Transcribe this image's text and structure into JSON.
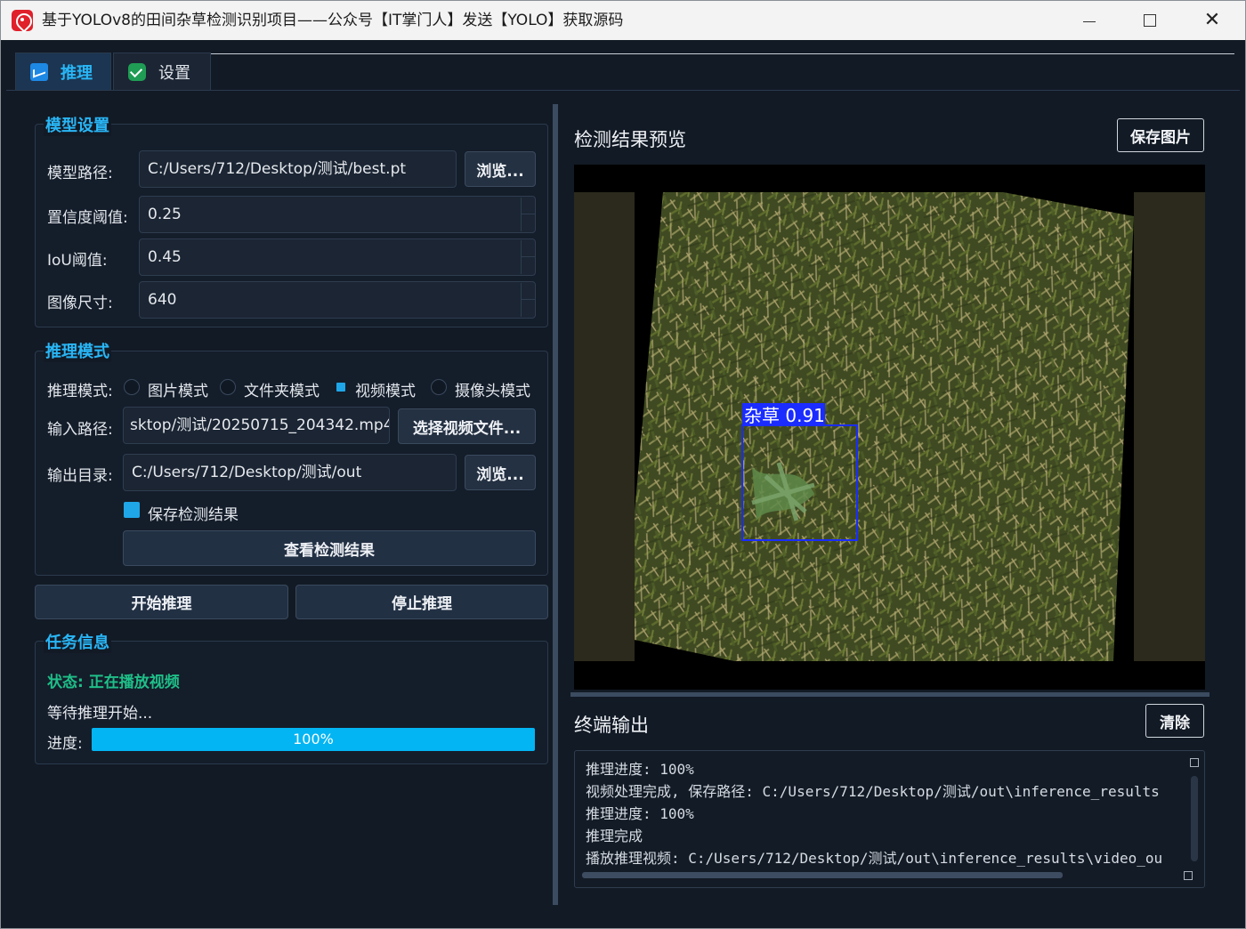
{
  "window": {
    "title": "基于YOLOv8的田间杂草检测识别项目——公众号【IT掌门人】发送【YOLO】获取源码"
  },
  "tabs": [
    {
      "label": "推理",
      "active": true
    },
    {
      "label": "设置",
      "active": false
    }
  ],
  "model_settings": {
    "title": "模型设置",
    "model_path_label": "模型路径:",
    "model_path": "C:/Users/712/Desktop/测试/best.pt",
    "browse_label": "浏览...",
    "conf_label": "置信度阈值:",
    "conf_value": "0.25",
    "iou_label": "IoU阈值:",
    "iou_value": "0.45",
    "imgsz_label": "图像尺寸:",
    "imgsz_value": "640"
  },
  "inference_mode": {
    "title": "推理模式",
    "mode_label": "推理模式:",
    "modes": [
      {
        "label": "图片模式",
        "selected": false
      },
      {
        "label": "文件夹模式",
        "selected": false
      },
      {
        "label": "视频模式",
        "selected": true
      },
      {
        "label": "摄像头模式",
        "selected": false
      }
    ],
    "input_label": "输入路径:",
    "input_value": "sktop/测试/20250715_204342.mp4",
    "select_video_label": "选择视频文件...",
    "output_label": "输出目录:",
    "output_value": "C:/Users/712/Desktop/测试/out",
    "browse_label": "浏览...",
    "save_results_label": "保存检测结果",
    "save_results_checked": true,
    "view_results_label": "查看检测结果"
  },
  "actions": {
    "start_label": "开始推理",
    "stop_label": "停止推理"
  },
  "task_info": {
    "title": "任务信息",
    "status": "状态: 正在播放视频",
    "message": "等待推理开始...",
    "progress_label": "进度:",
    "progress_value": 1.0,
    "progress_text": "100%"
  },
  "preview": {
    "heading": "检测结果预览",
    "save_image_label": "保存图片",
    "detection_label": "杂草 0.91",
    "box_color": "#1a2cff"
  },
  "terminal": {
    "heading": "终端输出",
    "clear_label": "清除",
    "lines": [
      "推理进度: 100%",
      "视频处理完成, 保存路径: C:/Users/712/Desktop/测试/out\\inference_results",
      "推理进度: 100%",
      "推理完成",
      "播放推理视频: C:/Users/712/Desktop/测试/out\\inference_results\\video_ou"
    ]
  },
  "colors": {
    "accent": "#29b6f6",
    "status": "#1fbf88",
    "progress": "#03b5f3",
    "background": "#121a25"
  }
}
